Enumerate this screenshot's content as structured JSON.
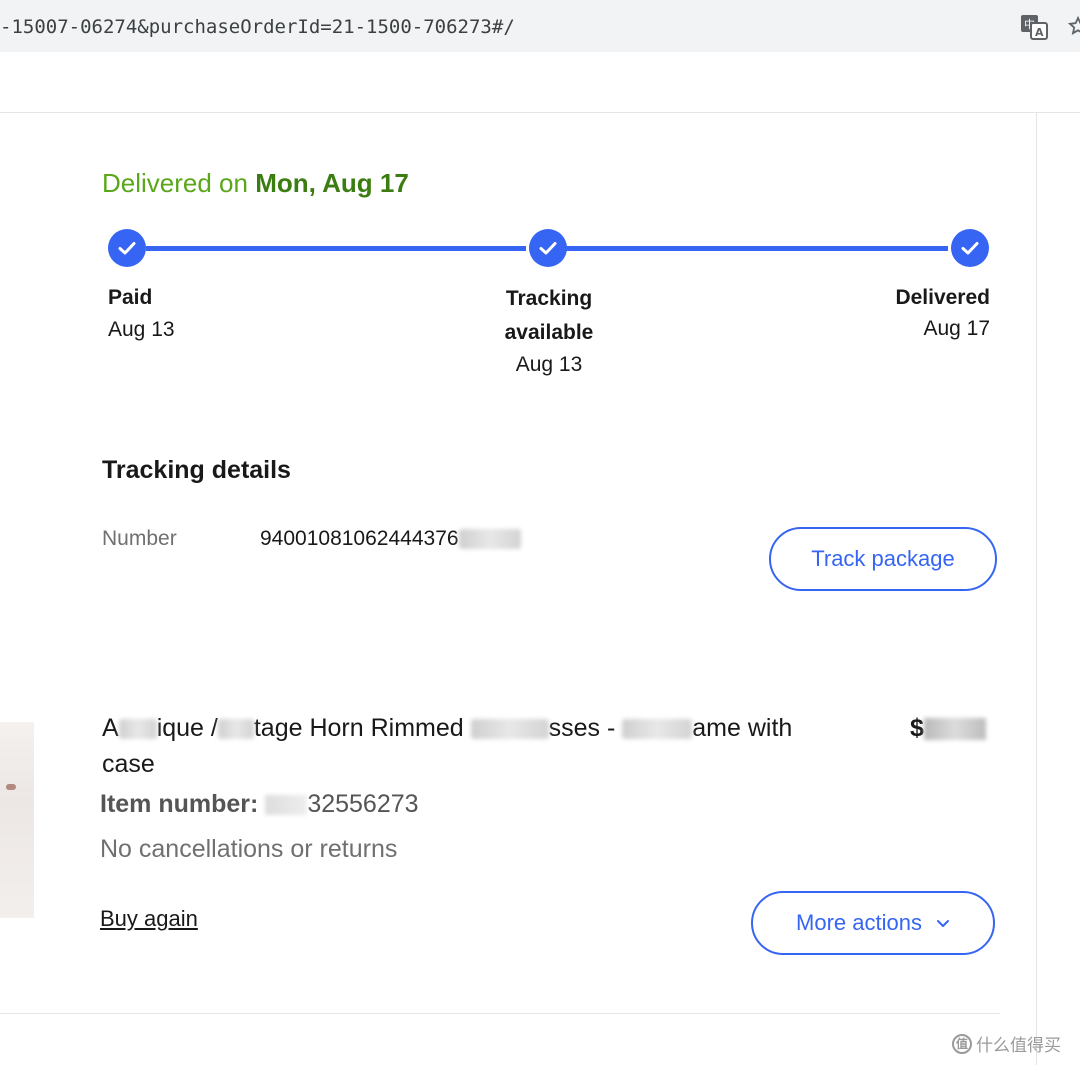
{
  "browser": {
    "url": "-15007-06274&purchaseOrderId=21-1500-706273#/"
  },
  "delivery": {
    "status_prefix": "Delivered on",
    "status_date": "Mon, Aug 17",
    "steps": [
      {
        "label": "Paid",
        "date": "Aug 13"
      },
      {
        "label_line1": "Tracking",
        "label_line2": "available",
        "date": "Aug 13"
      },
      {
        "label": "Delivered",
        "date": "Aug 17"
      }
    ]
  },
  "tracking": {
    "title": "Tracking details",
    "number_label": "Number",
    "number_value": "94001081062444376",
    "track_button": "Track package"
  },
  "item": {
    "title_line1_parts": [
      "A",
      "ique /",
      "tage Horn Rimmed",
      "sses -",
      "ame with"
    ],
    "title_line2": "case",
    "price_visible": "$",
    "number_label": "Item number:",
    "number_value": "32556273",
    "policy": "No cancellations or returns",
    "buy_again": "Buy again",
    "more_actions": "More actions"
  },
  "watermark": {
    "icon_text": "值",
    "text": "什么值得买"
  },
  "colors": {
    "accent_blue": "#3665f3",
    "delivered_green": "#5ba71b",
    "delivered_green_dark": "#3c7d12"
  }
}
